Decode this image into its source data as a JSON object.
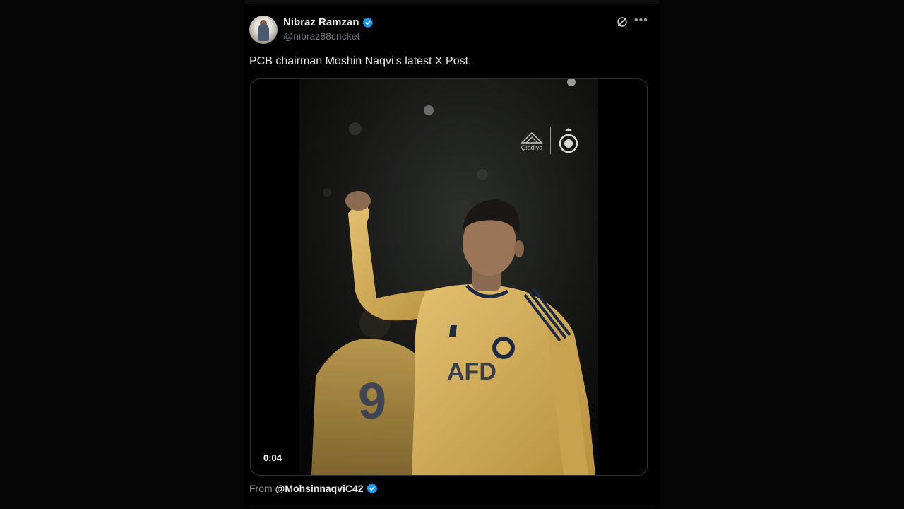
{
  "author": {
    "display_name": "Nibraz Ramzan",
    "handle": "@nibraz88cricket",
    "verified": true
  },
  "post": {
    "text": "PCB chairman Moshin Naqvi’s latest X Post."
  },
  "media": {
    "type": "video",
    "duration": "0:04",
    "brand_text": "Qiddiya",
    "shirt_text": "AFD",
    "background_player_number": "9"
  },
  "attribution": {
    "from_label": "From",
    "source_handle": "@MohsinnaqviC42",
    "verified": true
  },
  "icons": {
    "verified": "verified-badge-icon",
    "grok": "grok-icon",
    "more": "more-options-icon"
  },
  "colors": {
    "background": "#000000",
    "text_primary": "#e7e9ea",
    "text_secondary": "#71767b",
    "verified_blue": "#1d9bf0",
    "jersey_yellow": "#d8b45a"
  }
}
